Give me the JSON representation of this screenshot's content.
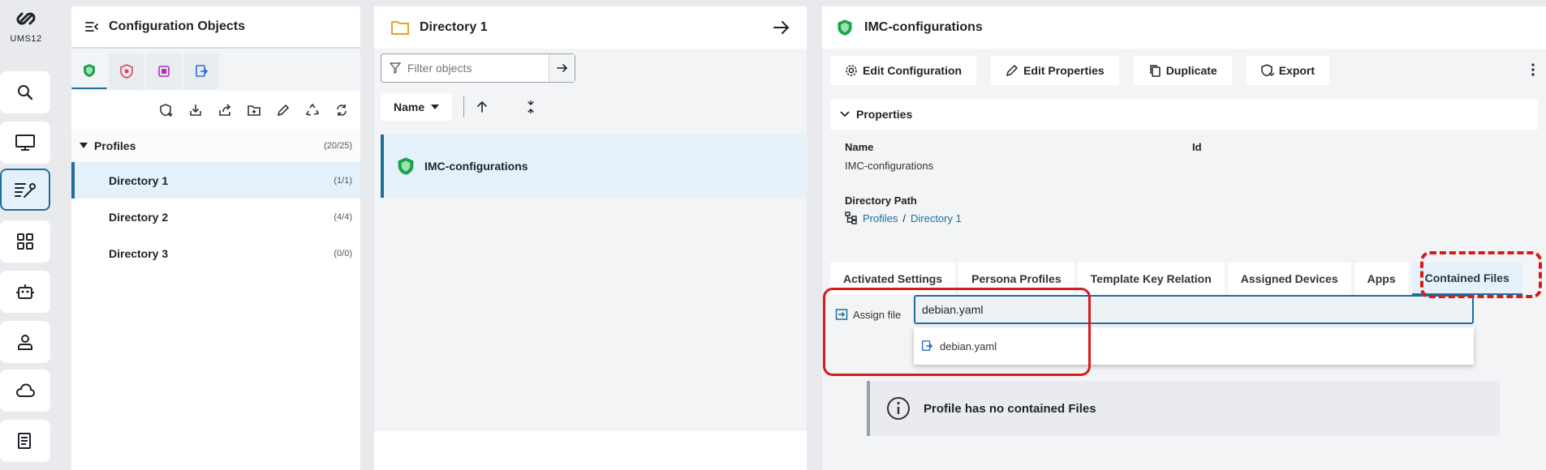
{
  "rail": {
    "logo_text": "UMS12",
    "items": [
      "search-icon",
      "monitor-icon",
      "configuration-icon",
      "apps-icon",
      "bot-icon",
      "user-icon",
      "cloud-icon",
      "document-icon"
    ]
  },
  "left_panel": {
    "title": "Configuration Objects",
    "tree": {
      "root_label": "Profiles",
      "root_count": "(20/25)",
      "items": [
        {
          "label": "Directory 1",
          "count": "(1/1)"
        },
        {
          "label": "Directory 2",
          "count": "(4/4)"
        },
        {
          "label": "Directory 3",
          "count": "(0/0)"
        }
      ]
    }
  },
  "middle_panel": {
    "title": "Directory 1",
    "filter_placeholder": "Filter objects",
    "sort_label": "Name",
    "objects": [
      {
        "label": "IMC-configurations"
      }
    ]
  },
  "right_panel": {
    "title": "IMC-configurations",
    "actions": {
      "edit_configuration": "Edit Configuration",
      "edit_properties": "Edit Properties",
      "duplicate": "Duplicate",
      "export": "Export"
    },
    "properties": {
      "header": "Properties",
      "name_label": "Name",
      "name_value": "IMC-configurations",
      "id_label": "Id",
      "path_label": "Directory Path",
      "path_root": "Profiles",
      "path_sep": "/",
      "path_leaf": "Directory 1"
    },
    "tabs": [
      "Activated Settings",
      "Persona Profiles",
      "Template Key Relation",
      "Assigned Devices",
      "Apps",
      "Contained Files"
    ],
    "assign": {
      "label": "Assign file",
      "input_value": "debian.yaml",
      "suggestion": "debian.yaml"
    },
    "empty_message": "Profile has no contained Files"
  },
  "colors": {
    "accent": "#1f6e9c",
    "highlight": "#d61b1b",
    "selected_bg": "#e4f1fb"
  }
}
